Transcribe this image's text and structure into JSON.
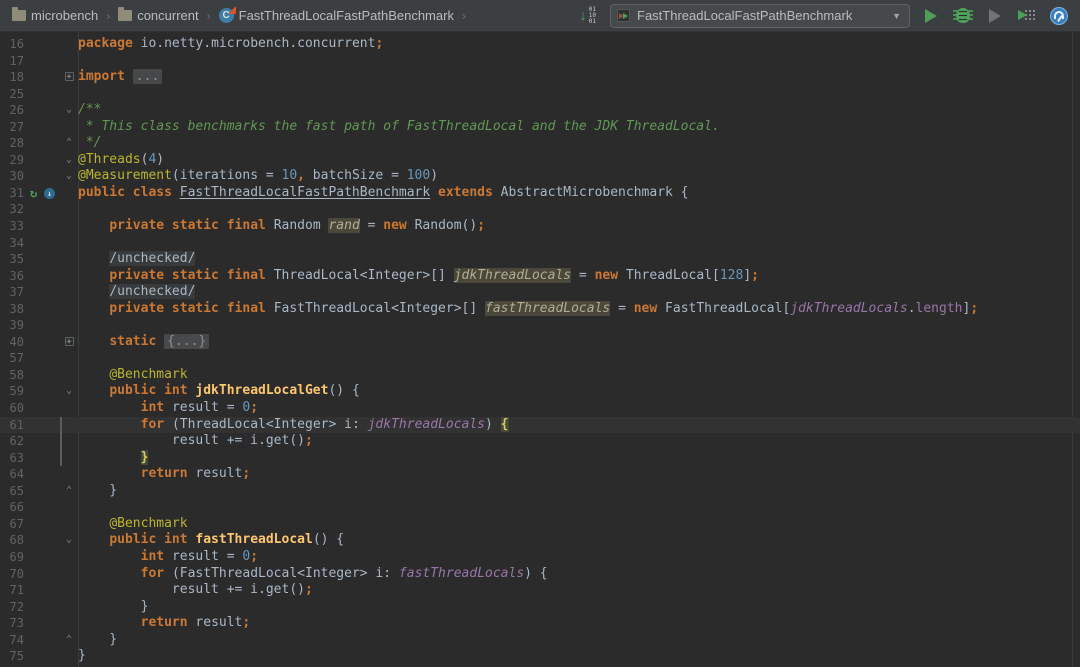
{
  "toolbar": {
    "breadcrumbs": [
      {
        "icon": "folder",
        "label": "microbench"
      },
      {
        "icon": "folder",
        "label": "concurrent"
      },
      {
        "icon": "class",
        "label": "FastThreadLocalFastPathBenchmark"
      }
    ],
    "run_config": {
      "label": "FastThreadLocalFastPathBenchmark"
    },
    "icons": {
      "binary_download": "vcs-binary-download-icon",
      "run": "run-icon",
      "debug": "debug-icon",
      "coverage": "run-with-coverage-icon-disabled",
      "profiler": "run-with-profiler-icon",
      "gauge": "profiler-gauge-icon"
    },
    "binary_digits": "01\n10\n01"
  },
  "colors": {
    "toolbar_bg": "#3C3F41",
    "editor_bg": "#2B2B2B",
    "caret_line": "#323232",
    "keyword": "#CC7832",
    "number": "#6897BB",
    "annotation": "#BBB529",
    "comment": "#629755",
    "field": "#9876AA",
    "method": "#FFC66D",
    "accent_green": "#4DA05A",
    "line_number": "#606366"
  },
  "editor": {
    "language": "java",
    "lines": [
      {
        "n": "16",
        "seg": [
          [
            "kw",
            "package"
          ],
          [
            "def",
            " io.netty.microbench.concurrent"
          ],
          [
            "kw",
            ";"
          ]
        ]
      },
      {
        "n": "17",
        "seg": []
      },
      {
        "n": "18",
        "fold": "plus",
        "seg": [
          [
            "kw",
            "import "
          ],
          [
            "fold",
            "..."
          ]
        ]
      },
      {
        "n": "25",
        "seg": []
      },
      {
        "n": "26",
        "fold": "down",
        "seg": [
          [
            "cmt",
            "/**"
          ]
        ]
      },
      {
        "n": "27",
        "seg": [
          [
            "cmt",
            " * This class benchmarks the fast path of FastThreadLocal and the JDK ThreadLocal."
          ]
        ]
      },
      {
        "n": "28",
        "fold": "up",
        "seg": [
          [
            "cmt",
            " */"
          ]
        ]
      },
      {
        "n": "29",
        "fold": "down",
        "seg": [
          [
            "ann",
            "@Threads"
          ],
          [
            "def",
            "("
          ],
          [
            "num",
            "4"
          ],
          [
            "def",
            ")"
          ]
        ]
      },
      {
        "n": "30",
        "fold": "down",
        "seg": [
          [
            "ann",
            "@Measurement"
          ],
          [
            "def",
            "(iterations = "
          ],
          [
            "num",
            "10"
          ],
          [
            "kw",
            ","
          ],
          [
            "def",
            " batchSize = "
          ],
          [
            "num",
            "100"
          ],
          [
            "def",
            ")"
          ]
        ]
      },
      {
        "n": "31",
        "icons": [
          "run",
          "overridden"
        ],
        "seg": [
          [
            "kw",
            "public class "
          ],
          [
            "cu",
            "FastThreadLocalFastPathBenchmark"
          ],
          [
            "kw",
            " extends "
          ],
          [
            "def",
            "AbstractMicrobenchmark {"
          ]
        ]
      },
      {
        "n": "32",
        "seg": []
      },
      {
        "n": "33",
        "seg": [
          [
            "def",
            "    "
          ],
          [
            "kw",
            "private static final "
          ],
          [
            "def",
            "Random "
          ],
          [
            "sfd",
            "rand"
          ],
          [
            "def",
            " = "
          ],
          [
            "kw",
            "new "
          ],
          [
            "def",
            "Random()"
          ],
          [
            "kw",
            ";"
          ]
        ]
      },
      {
        "n": "34",
        "seg": []
      },
      {
        "n": "35",
        "seg": [
          [
            "def",
            "    "
          ],
          [
            "fp",
            "/unchecked/"
          ]
        ]
      },
      {
        "n": "36",
        "seg": [
          [
            "def",
            "    "
          ],
          [
            "kw",
            "private static final "
          ],
          [
            "def",
            "ThreadLocal<Integer>[] "
          ],
          [
            "sfd",
            "jdkThreadLocals"
          ],
          [
            "def",
            " = "
          ],
          [
            "kw",
            "new "
          ],
          [
            "def",
            "ThreadLocal["
          ],
          [
            "num",
            "128"
          ],
          [
            "def",
            "]"
          ],
          [
            "kw",
            ";"
          ]
        ]
      },
      {
        "n": "37",
        "seg": [
          [
            "def",
            "    "
          ],
          [
            "fp",
            "/unchecked/"
          ]
        ]
      },
      {
        "n": "38",
        "seg": [
          [
            "def",
            "    "
          ],
          [
            "kw",
            "private static final "
          ],
          [
            "def",
            "FastThreadLocal<Integer>[] "
          ],
          [
            "sfd",
            "fastThreadLocals"
          ],
          [
            "def",
            " = "
          ],
          [
            "kw",
            "new "
          ],
          [
            "def",
            "FastThreadLocal["
          ],
          [
            "sf",
            "jdkThreadLocals"
          ],
          [
            "def",
            "."
          ],
          [
            "fld",
            "length"
          ],
          [
            "def",
            "]"
          ],
          [
            "kw",
            ";"
          ]
        ]
      },
      {
        "n": "39",
        "seg": []
      },
      {
        "n": "40",
        "fold": "plus",
        "seg": [
          [
            "def",
            "    "
          ],
          [
            "kw",
            "static "
          ],
          [
            "fold",
            "{...}"
          ]
        ]
      },
      {
        "n": "57",
        "seg": []
      },
      {
        "n": "58",
        "seg": [
          [
            "def",
            "    "
          ],
          [
            "ann",
            "@Benchmark"
          ]
        ]
      },
      {
        "n": "59",
        "fold": "down",
        "seg": [
          [
            "def",
            "    "
          ],
          [
            "kw",
            "public int "
          ],
          [
            "m",
            "jdkThreadLocalGet"
          ],
          [
            "def",
            "() {"
          ]
        ]
      },
      {
        "n": "60",
        "seg": [
          [
            "def",
            "        "
          ],
          [
            "kw",
            "int "
          ],
          [
            "def",
            "result = "
          ],
          [
            "num",
            "0"
          ],
          [
            "kw",
            ";"
          ]
        ]
      },
      {
        "n": "61",
        "caret": true,
        "bar": true,
        "bulb": true,
        "seg": [
          [
            "def",
            "        "
          ],
          [
            "kw",
            "for "
          ],
          [
            "def",
            "(ThreadLocal<Integer> i: "
          ],
          [
            "sf",
            "jdkThreadLocals"
          ],
          [
            "def",
            ") "
          ],
          [
            "br",
            "{"
          ]
        ]
      },
      {
        "n": "62",
        "bar": true,
        "seg": [
          [
            "def",
            "            result += i.get()"
          ],
          [
            "kw",
            ";"
          ]
        ]
      },
      {
        "n": "63",
        "bar": true,
        "seg": [
          [
            "def",
            "        "
          ],
          [
            "br",
            "}"
          ]
        ]
      },
      {
        "n": "64",
        "seg": [
          [
            "def",
            "        "
          ],
          [
            "kw",
            "return "
          ],
          [
            "def",
            "result"
          ],
          [
            "kw",
            ";"
          ]
        ]
      },
      {
        "n": "65",
        "fold": "up",
        "seg": [
          [
            "def",
            "    }"
          ]
        ]
      },
      {
        "n": "66",
        "seg": []
      },
      {
        "n": "67",
        "seg": [
          [
            "def",
            "    "
          ],
          [
            "ann",
            "@Benchmark"
          ]
        ]
      },
      {
        "n": "68",
        "fold": "down",
        "seg": [
          [
            "def",
            "    "
          ],
          [
            "kw",
            "public int "
          ],
          [
            "m",
            "fastThreadLocal"
          ],
          [
            "def",
            "() {"
          ]
        ]
      },
      {
        "n": "69",
        "seg": [
          [
            "def",
            "        "
          ],
          [
            "kw",
            "int "
          ],
          [
            "def",
            "result = "
          ],
          [
            "num",
            "0"
          ],
          [
            "kw",
            ";"
          ]
        ]
      },
      {
        "n": "70",
        "seg": [
          [
            "def",
            "        "
          ],
          [
            "kw",
            "for "
          ],
          [
            "def",
            "(FastThreadLocal<Integer> i: "
          ],
          [
            "sf",
            "fastThreadLocals"
          ],
          [
            "def",
            ") {"
          ]
        ]
      },
      {
        "n": "71",
        "seg": [
          [
            "def",
            "            result += i.get()"
          ],
          [
            "kw",
            ";"
          ]
        ]
      },
      {
        "n": "72",
        "seg": [
          [
            "def",
            "        }"
          ]
        ]
      },
      {
        "n": "73",
        "seg": [
          [
            "def",
            "        "
          ],
          [
            "kw",
            "return "
          ],
          [
            "def",
            "result"
          ],
          [
            "kw",
            ";"
          ]
        ]
      },
      {
        "n": "74",
        "fold": "up",
        "seg": [
          [
            "def",
            "    }"
          ]
        ]
      },
      {
        "n": "75",
        "seg": [
          [
            "def",
            "}"
          ]
        ]
      }
    ]
  }
}
